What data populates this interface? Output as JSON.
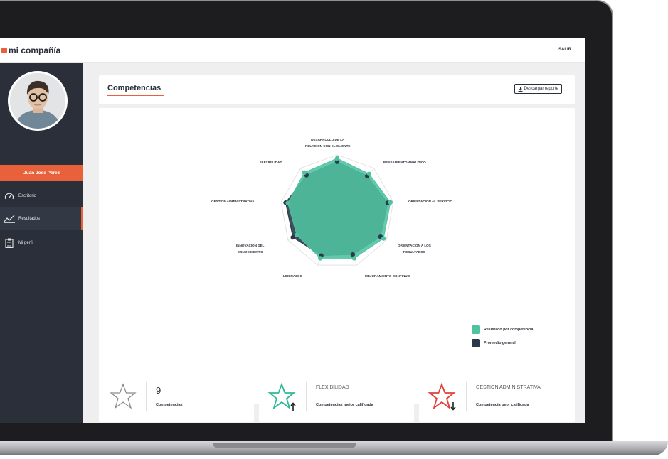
{
  "app": {
    "logo_text": "mi compañía",
    "logout_label": "SALIR"
  },
  "sidebar": {
    "user_name": "Juan José Pérez",
    "items": [
      {
        "label": "Escritorio",
        "icon": "speedometer-icon",
        "active": false
      },
      {
        "label": "Resultados",
        "icon": "line-chart-icon",
        "active": true
      },
      {
        "label": "Mi perfil",
        "icon": "clipboard-icon",
        "active": false
      }
    ]
  },
  "main": {
    "title": "Competencias",
    "download_label": "Descargar reporte"
  },
  "chart_data": {
    "type": "radar",
    "categories": [
      "DESARROLLO DE LA RELACION CON EL CLIENTE",
      "PENSAMIENTO ANALITICO",
      "ORIENTACION AL SERVICIO",
      "ORIENTACION A LOS RESULTADOS",
      "MEJORAMIENTO CONTINUO",
      "LIDERAZGO",
      "INNOVACION DEL CONOCIMIENTO",
      "GESTION ADMINISTRATIVA",
      "FLEXIBILIDAD"
    ],
    "series": [
      {
        "name": "Resultado por competencia",
        "values": [
          0.94,
          0.87,
          0.95,
          0.94,
          0.87,
          0.87,
          0.82,
          0.88,
          0.9
        ]
      },
      {
        "name": "Promedio general",
        "values": [
          0.88,
          0.82,
          0.9,
          0.88,
          0.8,
          0.82,
          0.9,
          0.92,
          0.84
        ]
      }
    ],
    "rlim": [
      0,
      1
    ],
    "grid_levels": 3,
    "legend": "bottom-right",
    "colors": {
      "result": "#4fc3a1",
      "average": "#2b3a4a"
    }
  },
  "stats": [
    {
      "value": "9",
      "caption": "Competencias",
      "icon": "star-outline-icon"
    },
    {
      "skill": "FLEXIBILIDAD",
      "caption": "Competencias mejor calificada",
      "icon": "star-up-icon"
    },
    {
      "skill": "GESTION ADMINISTRATIVA",
      "caption": "Competencia peor calificada",
      "icon": "star-down-icon"
    }
  ],
  "colors": {
    "accent": "#e8613b",
    "sidebar": "#2b2f3a",
    "success": "#2bb99a",
    "danger": "#e0403a"
  }
}
